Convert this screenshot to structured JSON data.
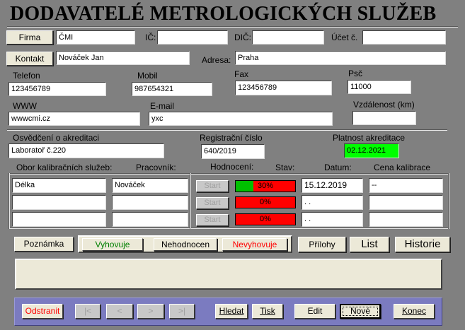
{
  "title": "DODAVATELÉ METROLOGICKÝCH SLUŽEB",
  "buttons": {
    "firma": "Firma",
    "kontakt": "Kontakt",
    "poznamka": "Poznámka",
    "vyhovuje": "Vyhovuje",
    "nehodnocen": "Nehodnocen",
    "nevyhovuje": "Nevyhovuje",
    "prilohy": "Přílohy",
    "list": "List",
    "historie": "Historie",
    "start": "Start"
  },
  "labels": {
    "ic": "IČ:",
    "dic": "DIČ:",
    "ucet": "Účet č.",
    "adresa": "Adresa:",
    "telefon": "Telefon",
    "mobil": "Mobil",
    "fax": "Fax",
    "psc": "Psč",
    "www": "WWW",
    "email": "E-mail",
    "vzdalenost": "Vzdálenost (km)",
    "osvedceni": "Osvědčení o akreditaci",
    "registracni": "Registrační číslo",
    "platnost": "Platnost akreditace",
    "obor": "Obor kalibračních služeb:",
    "pracovnik": "Pracovník:",
    "hodnoceni": "Hodnocení:",
    "stav": "Stav:",
    "datum": "Datum:",
    "cena": "Cena kalibrace"
  },
  "values": {
    "firma": "ČMI",
    "ic": "",
    "dic": "",
    "ucet": "",
    "kontakt": "Nováček Jan",
    "adresa": "Praha",
    "telefon": "123456789",
    "mobil": "987654321",
    "fax": "123456789",
    "psc": "11000",
    "www": "wwwcmi.cz",
    "email": "yxc",
    "vzdalenost": "",
    "osvedceni": "Laboratoř č.220",
    "registracni": "640/2019",
    "platnost": "02.12.2021",
    "poznamka": ""
  },
  "services": [
    {
      "obor": "Délka",
      "pracovnik": "Nováček",
      "stav_text": "30%",
      "stav_fraction": 0.3,
      "datum": "15.12.2019",
      "cena": "--"
    },
    {
      "obor": "",
      "pracovnik": "",
      "stav_text": "0%",
      "stav_fraction": 0.0,
      "datum": " .  .",
      "cena": ""
    },
    {
      "obor": "",
      "pracovnik": "",
      "stav_text": "0%",
      "stav_fraction": 0.0,
      "datum": " .  .",
      "cena": ""
    }
  ],
  "toolbar": {
    "odstranit": "Odstranit",
    "first": "|<",
    "prev": "<",
    "next": ">",
    "last": ">|",
    "hledat": "Hledat",
    "tisk": "Tisk",
    "edit": "Edit",
    "nove": "Nové",
    "konec": "Konec"
  },
  "colors": {
    "background": "#808080",
    "accredit_valid": "#00ff00",
    "bar_red": "#ff0000",
    "bar_green": "#00c000",
    "vyhovuje_text": "#008000",
    "nevyhovuje_text": "#ff0000",
    "odstranit_text": "#ff0000"
  }
}
